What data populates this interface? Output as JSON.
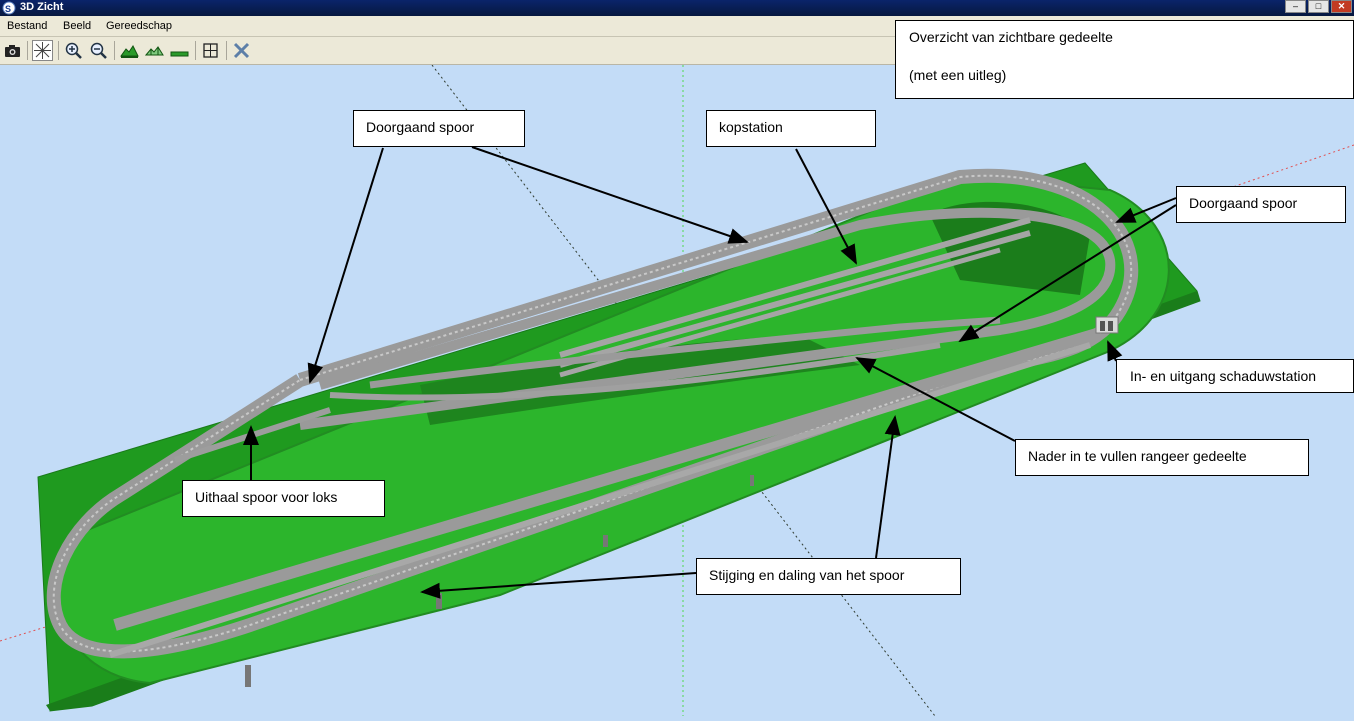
{
  "window": {
    "title": "3D Zicht"
  },
  "menu": [
    {
      "label": "Bestand"
    },
    {
      "label": "Beeld"
    },
    {
      "label": "Gereedschap"
    }
  ],
  "toolbar": [
    {
      "name": "camera-icon"
    },
    {
      "name": "orbit-axes-icon"
    },
    {
      "name": "zoom-in-icon"
    },
    {
      "name": "zoom-out-icon"
    },
    {
      "name": "terrain-view-icon"
    },
    {
      "name": "terrain-wire-icon"
    },
    {
      "name": "flat-view-icon"
    },
    {
      "name": "fit-view-icon"
    },
    {
      "name": "close-view-icon"
    }
  ],
  "overview": {
    "line1": "Overzicht van zichtbare gedeelte",
    "line2": "(met een uitleg)"
  },
  "annotations": {
    "doorgaand_left": "Doorgaand spoor",
    "kopstation": "kopstation",
    "doorgaand_right": "Doorgaand spoor",
    "schaduwstation": "In- en uitgang schaduwstation",
    "rangeer": "Nader in te vullen rangeer gedeelte",
    "uithaal": "Uithaal spoor voor loks",
    "stijging": "Stijging en daling van het spoor"
  },
  "colors": {
    "sky": "#c3dcf7",
    "terrain": "#22a822",
    "terrain_dark": "#1c7f1c",
    "track": "#a8a8a8",
    "titlebar": "#0a246a"
  }
}
